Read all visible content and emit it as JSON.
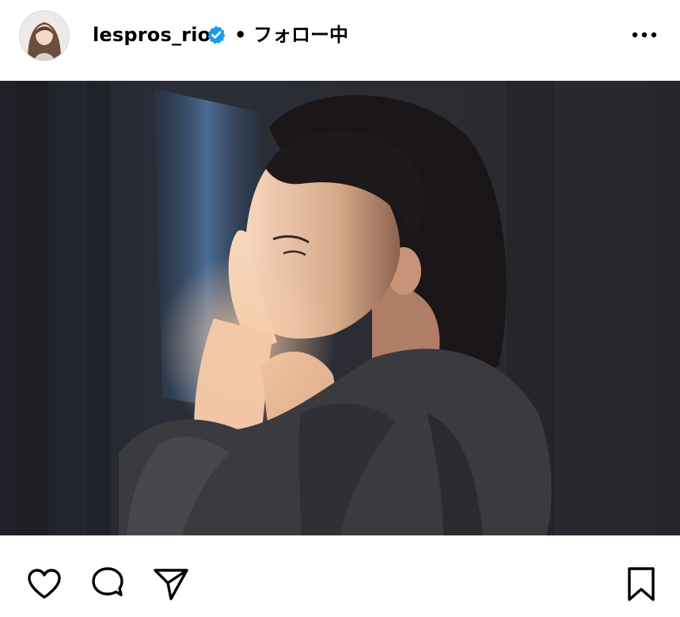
{
  "post": {
    "username": "lespros_rio",
    "verified": true,
    "separator": "•",
    "follow_status": "フォロー中",
    "more_icon": "more-horizontal-icon"
  },
  "actions": {
    "like_icon": "heart-icon",
    "comment_icon": "comment-icon",
    "share_icon": "send-icon",
    "save_icon": "bookmark-icon"
  },
  "colors": {
    "verified_badge": "#1d9bf0",
    "photo_background": "#23232a",
    "text": "#000000"
  }
}
